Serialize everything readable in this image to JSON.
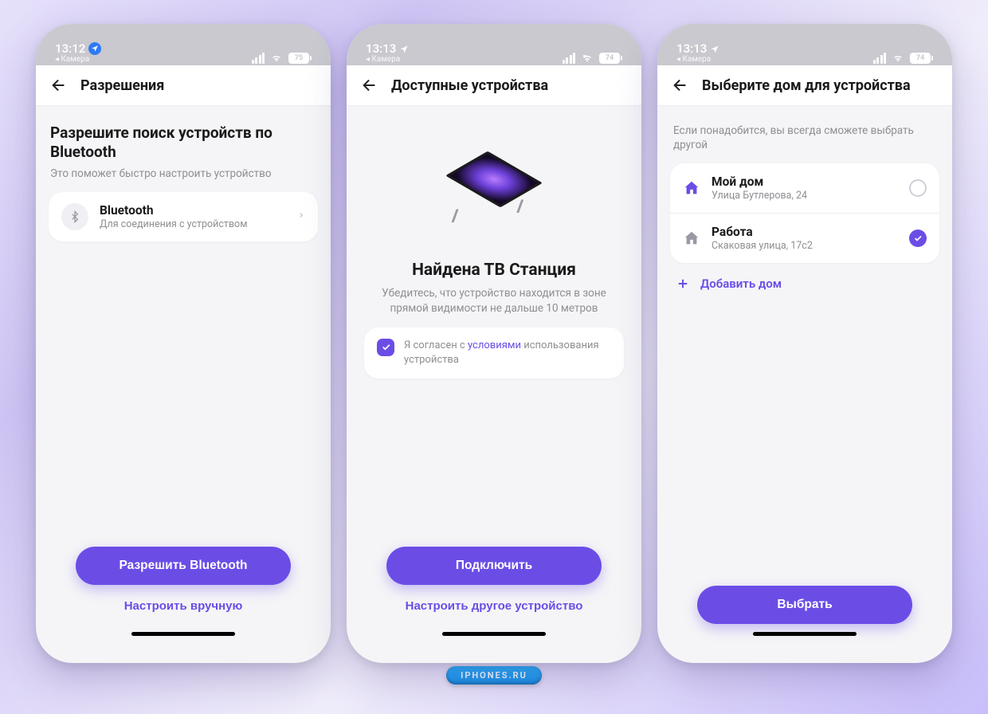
{
  "watermark": "IPHONES.RU",
  "status": {
    "back_app": "◂ Камера",
    "times": [
      "13:12",
      "13:13",
      "13:13"
    ],
    "battery": [
      "75",
      "74",
      "74"
    ]
  },
  "screen1": {
    "nav_title": "Разрешения",
    "heading": "Разрешите поиск устройств по Bluetooth",
    "sub": "Это поможет быстро настроить устройство",
    "bt_title": "Bluetooth",
    "bt_sub": "Для соединения с устройством",
    "primary": "Разрешить Bluetooth",
    "secondary": "Настроить вручную"
  },
  "screen2": {
    "nav_title": "Доступные устройства",
    "found_title": "Найдена ТВ Станция",
    "found_sub": "Убедитесь, что устройство находится в зоне прямой видимости не дальше 10 метров",
    "agree_prefix": "Я согласен с ",
    "agree_link": "условиями",
    "agree_suffix": " использования устройства",
    "primary": "Подключить",
    "secondary": "Настроить другое устройство"
  },
  "screen3": {
    "nav_title": "Выберите дом для устройства",
    "info": "Если понадобится, вы всегда сможете выбрать другой",
    "homes": [
      {
        "name": "Мой дом",
        "addr": "Улица Бутлерова, 24",
        "selected": false,
        "color": "#6b4de6"
      },
      {
        "name": "Работа",
        "addr": "Скаковая улица, 17с2",
        "selected": true,
        "color": "#9a9aa6"
      }
    ],
    "add_label": "Добавить дом",
    "primary": "Выбрать"
  }
}
